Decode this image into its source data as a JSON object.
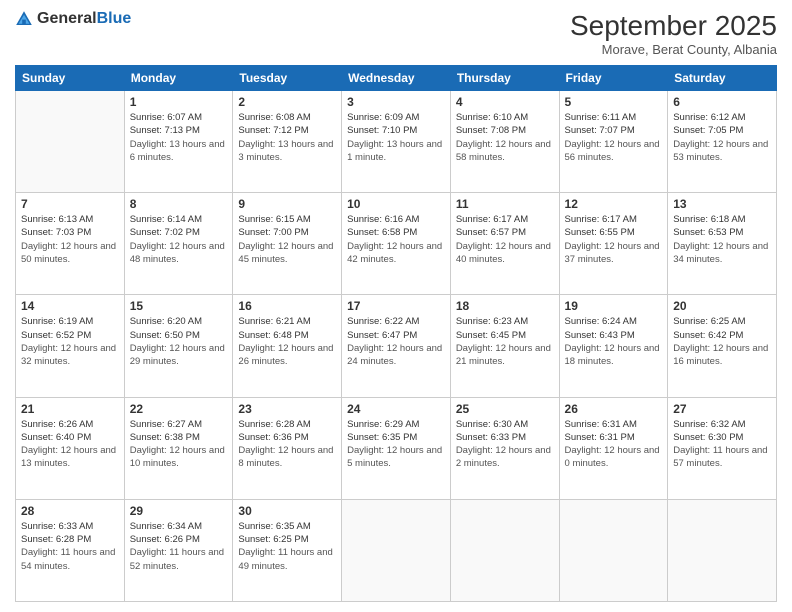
{
  "logo": {
    "text_general": "General",
    "text_blue": "Blue"
  },
  "header": {
    "month_title": "September 2025",
    "subtitle": "Morave, Berat County, Albania"
  },
  "days_of_week": [
    "Sunday",
    "Monday",
    "Tuesday",
    "Wednesday",
    "Thursday",
    "Friday",
    "Saturday"
  ],
  "weeks": [
    [
      {
        "num": "",
        "sunrise": "",
        "sunset": "",
        "daylight": ""
      },
      {
        "num": "1",
        "sunrise": "Sunrise: 6:07 AM",
        "sunset": "Sunset: 7:13 PM",
        "daylight": "Daylight: 13 hours and 6 minutes."
      },
      {
        "num": "2",
        "sunrise": "Sunrise: 6:08 AM",
        "sunset": "Sunset: 7:12 PM",
        "daylight": "Daylight: 13 hours and 3 minutes."
      },
      {
        "num": "3",
        "sunrise": "Sunrise: 6:09 AM",
        "sunset": "Sunset: 7:10 PM",
        "daylight": "Daylight: 13 hours and 1 minute."
      },
      {
        "num": "4",
        "sunrise": "Sunrise: 6:10 AM",
        "sunset": "Sunset: 7:08 PM",
        "daylight": "Daylight: 12 hours and 58 minutes."
      },
      {
        "num": "5",
        "sunrise": "Sunrise: 6:11 AM",
        "sunset": "Sunset: 7:07 PM",
        "daylight": "Daylight: 12 hours and 56 minutes."
      },
      {
        "num": "6",
        "sunrise": "Sunrise: 6:12 AM",
        "sunset": "Sunset: 7:05 PM",
        "daylight": "Daylight: 12 hours and 53 minutes."
      }
    ],
    [
      {
        "num": "7",
        "sunrise": "Sunrise: 6:13 AM",
        "sunset": "Sunset: 7:03 PM",
        "daylight": "Daylight: 12 hours and 50 minutes."
      },
      {
        "num": "8",
        "sunrise": "Sunrise: 6:14 AM",
        "sunset": "Sunset: 7:02 PM",
        "daylight": "Daylight: 12 hours and 48 minutes."
      },
      {
        "num": "9",
        "sunrise": "Sunrise: 6:15 AM",
        "sunset": "Sunset: 7:00 PM",
        "daylight": "Daylight: 12 hours and 45 minutes."
      },
      {
        "num": "10",
        "sunrise": "Sunrise: 6:16 AM",
        "sunset": "Sunset: 6:58 PM",
        "daylight": "Daylight: 12 hours and 42 minutes."
      },
      {
        "num": "11",
        "sunrise": "Sunrise: 6:17 AM",
        "sunset": "Sunset: 6:57 PM",
        "daylight": "Daylight: 12 hours and 40 minutes."
      },
      {
        "num": "12",
        "sunrise": "Sunrise: 6:17 AM",
        "sunset": "Sunset: 6:55 PM",
        "daylight": "Daylight: 12 hours and 37 minutes."
      },
      {
        "num": "13",
        "sunrise": "Sunrise: 6:18 AM",
        "sunset": "Sunset: 6:53 PM",
        "daylight": "Daylight: 12 hours and 34 minutes."
      }
    ],
    [
      {
        "num": "14",
        "sunrise": "Sunrise: 6:19 AM",
        "sunset": "Sunset: 6:52 PM",
        "daylight": "Daylight: 12 hours and 32 minutes."
      },
      {
        "num": "15",
        "sunrise": "Sunrise: 6:20 AM",
        "sunset": "Sunset: 6:50 PM",
        "daylight": "Daylight: 12 hours and 29 minutes."
      },
      {
        "num": "16",
        "sunrise": "Sunrise: 6:21 AM",
        "sunset": "Sunset: 6:48 PM",
        "daylight": "Daylight: 12 hours and 26 minutes."
      },
      {
        "num": "17",
        "sunrise": "Sunrise: 6:22 AM",
        "sunset": "Sunset: 6:47 PM",
        "daylight": "Daylight: 12 hours and 24 minutes."
      },
      {
        "num": "18",
        "sunrise": "Sunrise: 6:23 AM",
        "sunset": "Sunset: 6:45 PM",
        "daylight": "Daylight: 12 hours and 21 minutes."
      },
      {
        "num": "19",
        "sunrise": "Sunrise: 6:24 AM",
        "sunset": "Sunset: 6:43 PM",
        "daylight": "Daylight: 12 hours and 18 minutes."
      },
      {
        "num": "20",
        "sunrise": "Sunrise: 6:25 AM",
        "sunset": "Sunset: 6:42 PM",
        "daylight": "Daylight: 12 hours and 16 minutes."
      }
    ],
    [
      {
        "num": "21",
        "sunrise": "Sunrise: 6:26 AM",
        "sunset": "Sunset: 6:40 PM",
        "daylight": "Daylight: 12 hours and 13 minutes."
      },
      {
        "num": "22",
        "sunrise": "Sunrise: 6:27 AM",
        "sunset": "Sunset: 6:38 PM",
        "daylight": "Daylight: 12 hours and 10 minutes."
      },
      {
        "num": "23",
        "sunrise": "Sunrise: 6:28 AM",
        "sunset": "Sunset: 6:36 PM",
        "daylight": "Daylight: 12 hours and 8 minutes."
      },
      {
        "num": "24",
        "sunrise": "Sunrise: 6:29 AM",
        "sunset": "Sunset: 6:35 PM",
        "daylight": "Daylight: 12 hours and 5 minutes."
      },
      {
        "num": "25",
        "sunrise": "Sunrise: 6:30 AM",
        "sunset": "Sunset: 6:33 PM",
        "daylight": "Daylight: 12 hours and 2 minutes."
      },
      {
        "num": "26",
        "sunrise": "Sunrise: 6:31 AM",
        "sunset": "Sunset: 6:31 PM",
        "daylight": "Daylight: 12 hours and 0 minutes."
      },
      {
        "num": "27",
        "sunrise": "Sunrise: 6:32 AM",
        "sunset": "Sunset: 6:30 PM",
        "daylight": "Daylight: 11 hours and 57 minutes."
      }
    ],
    [
      {
        "num": "28",
        "sunrise": "Sunrise: 6:33 AM",
        "sunset": "Sunset: 6:28 PM",
        "daylight": "Daylight: 11 hours and 54 minutes."
      },
      {
        "num": "29",
        "sunrise": "Sunrise: 6:34 AM",
        "sunset": "Sunset: 6:26 PM",
        "daylight": "Daylight: 11 hours and 52 minutes."
      },
      {
        "num": "30",
        "sunrise": "Sunrise: 6:35 AM",
        "sunset": "Sunset: 6:25 PM",
        "daylight": "Daylight: 11 hours and 49 minutes."
      },
      {
        "num": "",
        "sunrise": "",
        "sunset": "",
        "daylight": ""
      },
      {
        "num": "",
        "sunrise": "",
        "sunset": "",
        "daylight": ""
      },
      {
        "num": "",
        "sunrise": "",
        "sunset": "",
        "daylight": ""
      },
      {
        "num": "",
        "sunrise": "",
        "sunset": "",
        "daylight": ""
      }
    ]
  ]
}
